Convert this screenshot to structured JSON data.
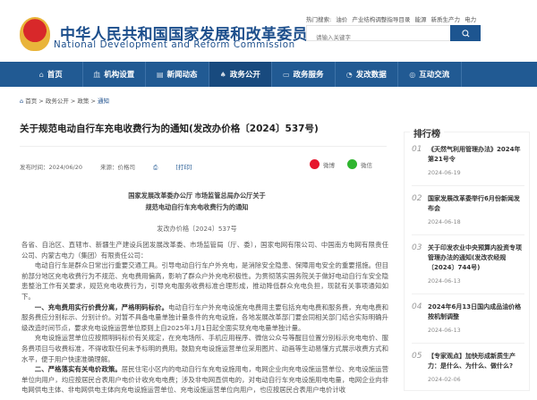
{
  "header": {
    "logo_cn": "中华人民共和国国家发展和改革委员会",
    "logo_en": "National Development and Reform Commission",
    "hot_label": "热门搜索:",
    "hot_terms": [
      "油价",
      "产业结构调整指导目录",
      "能源",
      "新质生产力",
      "电力"
    ],
    "search_placeholder": "请输入关键字"
  },
  "nav": [
    {
      "label": "首页",
      "icon": "⌂"
    },
    {
      "label": "机构设置",
      "icon": "⾎"
    },
    {
      "label": "新闻动态",
      "icon": "▤"
    },
    {
      "label": "政务公开",
      "icon": "♠"
    },
    {
      "label": "政务服务",
      "icon": "▭"
    },
    {
      "label": "发改数据",
      "icon": "◔"
    },
    {
      "label": "互动交流",
      "icon": "◎"
    }
  ],
  "breadcrumb": [
    "首页",
    "政务公开",
    "政策",
    "通知"
  ],
  "article": {
    "title": "关于规范电动自行车充电收费行为的通知(发改办价格〔2024〕537号)",
    "date": "发布时间：2024/06/20",
    "source": "来源：价格司",
    "print": "[打印]",
    "weibo": "微博",
    "wechat": "微信",
    "head1": "国家发展改革委办公厅 市场监管总局办公厅关于",
    "head2": "规范电动自行车充电收费行为的通知",
    "doc_no": "发改办价格〔2024〕537号",
    "p1": "各省、自治区、直辖市、新疆生产建设兵团发展改革委、市场监管局（厅、委），国家电网有限公司、中国南方电网有限责任公司、内蒙古电力（集团）有限责任公司：",
    "p2": "电动自行车是群众日常出行重要交通工具。引导电动自行车户外充电，是消除安全隐患、保障用电安全的重要措施。但目前部分地区充电收费行为不规范、充电费用偏高，影响了群众户外充电积极性。为贯彻落实国务院关于做好电动自行车安全隐患整治工作有关要求，规范充电收费行为，引导充电服务收费标准合理形成，推动降低群众充电负担，现就有关事项通知如下。",
    "p3_bold": "一、充电费用实行价费分离，严格明码标价。",
    "p3": "电动自行车户外充电设施充电费用主要包括充电电费和服务费，充电电费和服务费应分别标示、分别计价。对暂不具备电量单独计量条件的充电设施，各地发展改革部门要会同相关部门结合实际明确升级改造时间节点，要求充电设施运营单位原则上自2025年1月1日起全面实现充电电量单独计量。",
    "p4": "充电设施运营单位应按照明码标价有关规定，在充电场所、手机应用程序、微信公众号等醒目位置分别标示充电电价、服务费项目与收费标准，不得收取任何未予标明的费用。鼓励充电设施运营单位采用图片、动画等生动易懂方式展示收费方式和水平，便于用户快速准确理解。",
    "p5_bold": "二、严格落实有关电价政策。",
    "p5": "居民住宅小区内的电动自行车充电设施用电，电网企业向充电设施运营单位、充电设施运营单位向用户，均应按居民合表用户电价计收充电电费；涉及非电网直供电的，对电动自行车充电设施用电电量，电网企业向非电网供电主体、非电网供电主体向充电设施运营单位、充电设施运营单位向用户，也应按居民合表用户电价计收"
  },
  "ranking": {
    "title": "排行榜",
    "items": [
      {
        "num": "01",
        "title": "《天然气利用管理办法》2024年第21号令",
        "date": "2024-06-19"
      },
      {
        "num": "02",
        "title": "国家发展改革委举行6月份新闻发布会",
        "date": "2024-06-18"
      },
      {
        "num": "03",
        "title": "关于印发农业中央预算内投资专项管理办法的通知(发改农经规〔2024〕744号)",
        "date": "2024-06-13"
      },
      {
        "num": "04",
        "title": "2024年6月13日国内成品油价格按机制调整",
        "date": "2024-06-13"
      },
      {
        "num": "05",
        "title": "【专家观点】加快形成新质生产力：是什么、为什么、做什么?",
        "date": "2024-02-06"
      }
    ]
  },
  "colors": {
    "nav": "#215a93",
    "brand": "#1d4f8c"
  }
}
